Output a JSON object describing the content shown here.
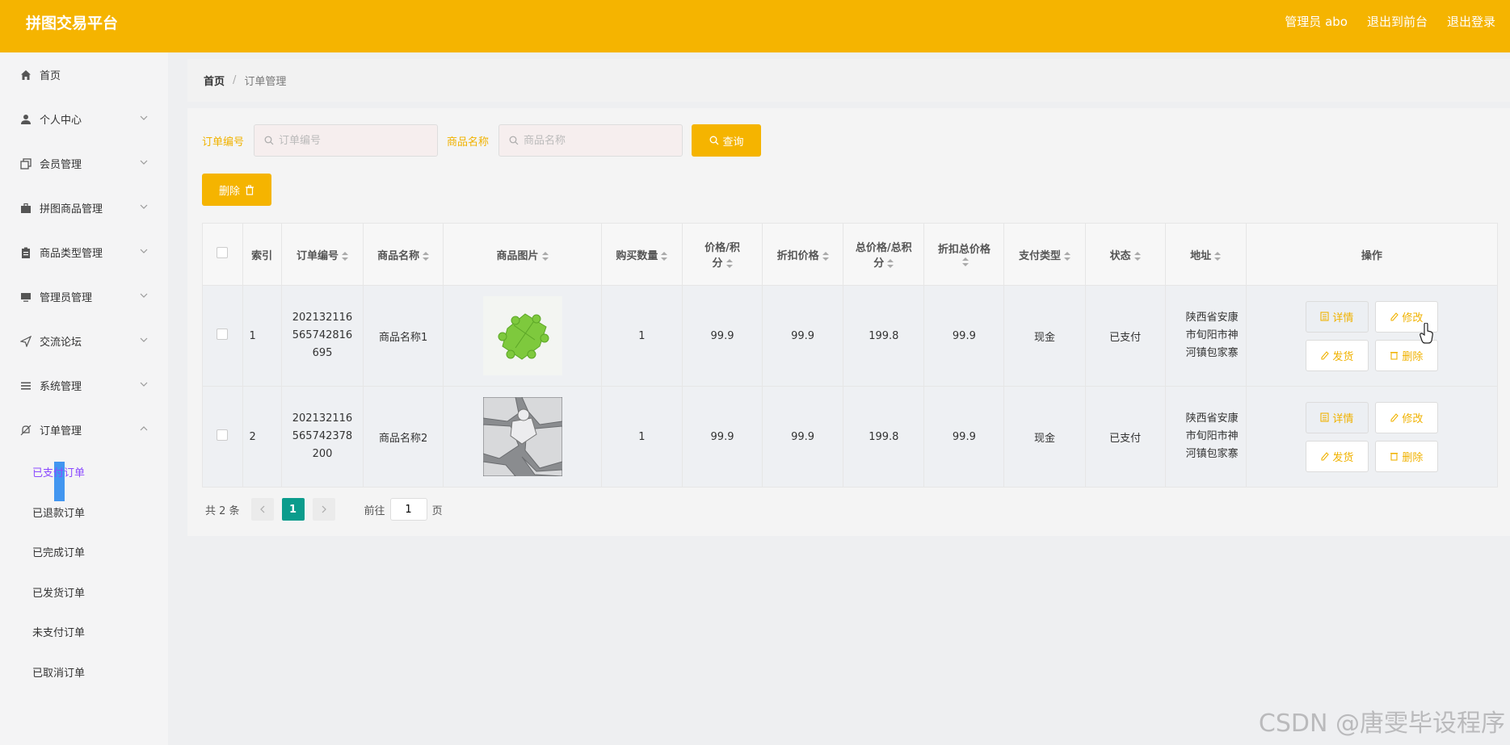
{
  "header": {
    "brand": "拼图交易平台",
    "admin_label": "管理员 abo",
    "back_to_front": "退出到前台",
    "logout": "退出登录"
  },
  "sidebar": {
    "items": [
      {
        "label": "首页",
        "icon": "home-icon"
      },
      {
        "label": "个人中心",
        "icon": "user-icon"
      },
      {
        "label": "会员管理",
        "icon": "copy-icon"
      },
      {
        "label": "拼图商品管理",
        "icon": "briefcase-icon"
      },
      {
        "label": "商品类型管理",
        "icon": "clipboard-icon"
      },
      {
        "label": "管理员管理",
        "icon": "monitor-icon"
      },
      {
        "label": "交流论坛",
        "icon": "send-icon"
      },
      {
        "label": "系统管理",
        "icon": "menu-icon"
      },
      {
        "label": "订单管理",
        "icon": "bell-off-icon"
      }
    ],
    "order_submenu": [
      "已支付订单",
      "已退款订单",
      "已完成订单",
      "已发货订单",
      "未支付订单",
      "已取消订单"
    ]
  },
  "breadcrumb": {
    "home": "首页",
    "separator": "/",
    "current": "订单管理"
  },
  "search": {
    "order_no_label": "订单编号",
    "order_no_placeholder": "订单编号",
    "product_label": "商品名称",
    "product_placeholder": "商品名称",
    "query_button": "查询"
  },
  "toolbar": {
    "delete_label": "删除"
  },
  "table": {
    "headers": {
      "index": "索引",
      "order_no": "订单编号",
      "product_name": "商品名称",
      "product_image": "商品图片",
      "quantity": "购买数量",
      "price_a": "价格/积",
      "price_b": "分",
      "discount_price": "折扣价格",
      "total_a": "总价格/总积",
      "total_b": "分",
      "discount_total": "折扣总价格",
      "pay_type": "支付类型",
      "status": "状态",
      "address": "地址",
      "actions": "操作"
    },
    "rows": [
      {
        "index": "1",
        "order_no_1": "202132116",
        "order_no_2": "565742816",
        "order_no_3": "695",
        "product_name": "商品名称1",
        "image": "green-puzzle-image",
        "quantity": "1",
        "price": "99.9",
        "discount_price": "99.9",
        "total": "199.8",
        "discount_total": "99.9",
        "pay_type": "现金",
        "status": "已支付",
        "address_1": "陕西省安康",
        "address_2": "市旬阳市神",
        "address_3": "河镇包家寨"
      },
      {
        "index": "2",
        "order_no_1": "202132116",
        "order_no_2": "565742378",
        "order_no_3": "200",
        "product_name": "商品名称2",
        "image": "gray-puzzle-image",
        "quantity": "1",
        "price": "99.9",
        "discount_price": "99.9",
        "total": "199.8",
        "discount_total": "99.9",
        "pay_type": "现金",
        "status": "已支付",
        "address_1": "陕西省安康",
        "address_2": "市旬阳市神",
        "address_3": "河镇包家寨"
      }
    ],
    "actions": {
      "detail": "详情",
      "edit": "修改",
      "ship": "发货",
      "delete": "删除"
    }
  },
  "pagination": {
    "total": "共 2 条",
    "current_page": "1",
    "goto_prefix": "前往",
    "goto_value": "1",
    "goto_suffix": "页"
  },
  "watermark": "CSDN @唐雯毕设程序",
  "colors": {
    "primary": "#f5b400",
    "page_active": "#0b9c8c",
    "submenu_active": "#8b4aff"
  }
}
